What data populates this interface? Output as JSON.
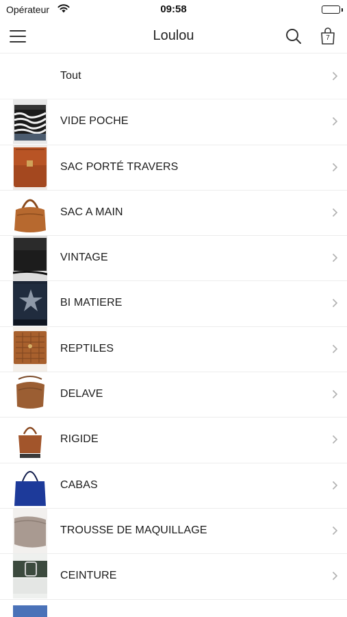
{
  "status_bar": {
    "carrier": "Opérateur",
    "time": "09:58",
    "battery_level": 1.0
  },
  "nav": {
    "title": "Loulou",
    "cart_count": "7"
  },
  "categories": [
    {
      "label": "Tout",
      "icon": ""
    },
    {
      "label": "VIDE POCHE",
      "icon": "zebra-pouch-thumbnail"
    },
    {
      "label": "SAC PORTÉ TRAVERS",
      "icon": "brown-crossbody-bag-thumbnail"
    },
    {
      "label": "SAC A MAIN",
      "icon": "cognac-handbag-thumbnail"
    },
    {
      "label": "VINTAGE",
      "icon": "black-vintage-bag-thumbnail"
    },
    {
      "label": "BI MATIERE",
      "icon": "star-bag-thumbnail"
    },
    {
      "label": "REPTILES",
      "icon": "reptile-clutch-thumbnail"
    },
    {
      "label": "DELAVE",
      "icon": "washed-leather-bag-thumbnail"
    },
    {
      "label": "RIGIDE",
      "icon": "rigid-tote-thumbnail"
    },
    {
      "label": "CABAS",
      "icon": "blue-suede-tote-thumbnail"
    },
    {
      "label": "TROUSSE DE MAQUILLAGE",
      "icon": "taupe-makeup-pouch-thumbnail"
    },
    {
      "label": "CEINTURE",
      "icon": "belt-thumbnail"
    },
    {
      "label": "",
      "icon": "denim-item-thumbnail"
    }
  ],
  "colors": {
    "accent": "#222222",
    "divider": "#ececec",
    "chevron": "#b0b0b0"
  }
}
